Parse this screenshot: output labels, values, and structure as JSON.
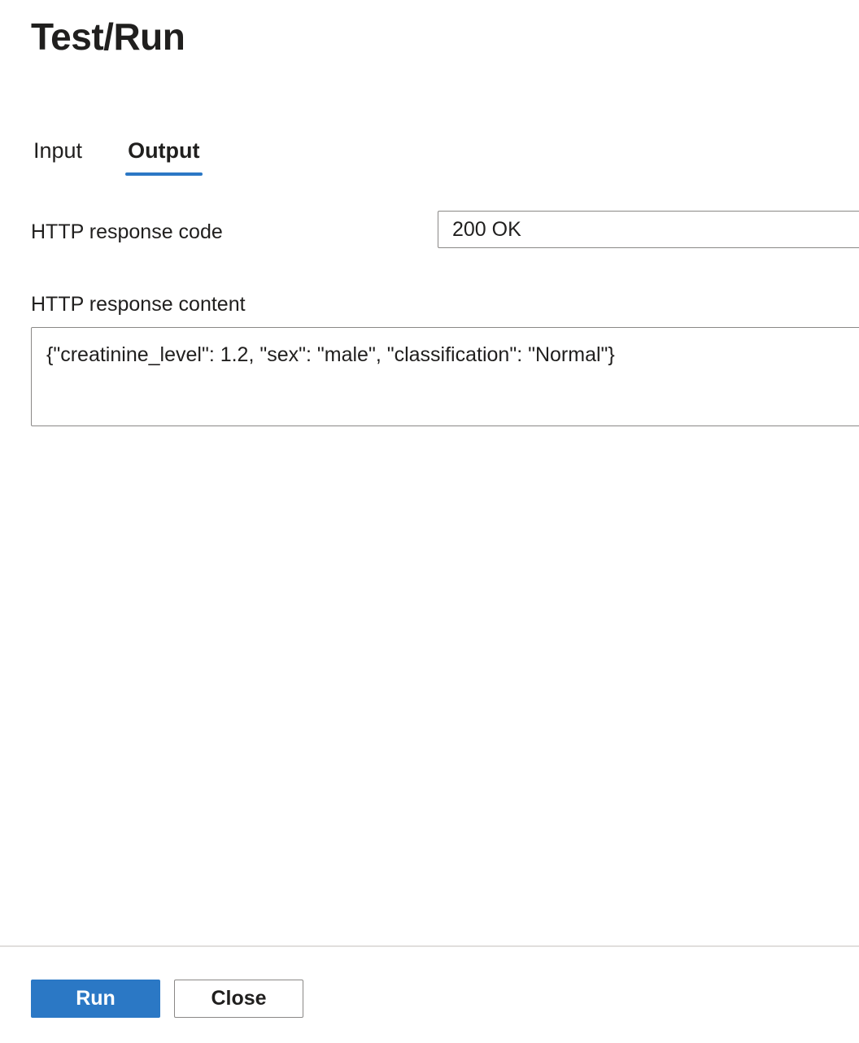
{
  "title": "Test/Run",
  "tabs": [
    {
      "label": "Input",
      "selected": false
    },
    {
      "label": "Output",
      "selected": true
    }
  ],
  "output": {
    "response_code_label": "HTTP response code",
    "response_code_value": "200 OK",
    "response_content_label": "HTTP response content",
    "response_content_value": "{\"creatinine_level\": 1.2, \"sex\": \"male\", \"classification\": \"Normal\"}"
  },
  "footer": {
    "run_label": "Run",
    "close_label": "Close"
  },
  "colors": {
    "accent": "#2b78c5",
    "text": "#201f1e",
    "border": "#8a8886",
    "divider": "#e1dfdd"
  }
}
